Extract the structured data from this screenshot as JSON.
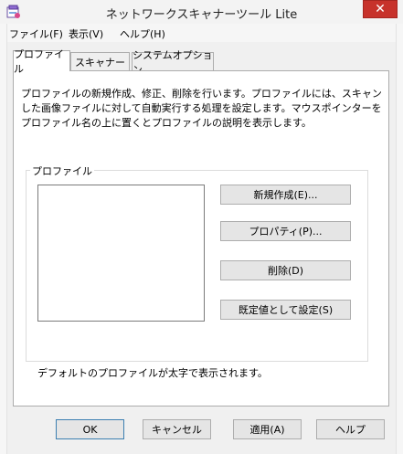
{
  "window": {
    "title": "ネットワークスキャナーツール Lite",
    "close_glyph": "✕",
    "app_icon": "scanner-app-icon"
  },
  "menu": [
    "ファイル(F)",
    "表示(V)",
    "ヘルプ(H)"
  ],
  "tabs": [
    {
      "label": "プロファイル",
      "active": true
    },
    {
      "label": "スキャナー",
      "active": false
    },
    {
      "label": "システムオプション",
      "active": false
    }
  ],
  "profile_tab": {
    "description": "プロファイルの新規作成、修正、削除を行います。プロファイルには、スキャンした画像ファイルに対して自動実行する処理を設定します。マウスポインターをプロファイル名の上に置くとプロファイルの説明を表示します。",
    "group_label": "プロファイル",
    "buttons": {
      "new": "新規作成(E)...",
      "properties": "プロパティ(P)...",
      "delete": "削除(D)",
      "set_default": "既定値として設定(S)"
    },
    "note": "デフォルトのプロファイルが太字で表示されます。"
  },
  "dialog_buttons": {
    "ok": "OK",
    "cancel": "キャンセル",
    "apply": "適用(A)",
    "help": "ヘルプ"
  },
  "colors": {
    "close_button": "#c7322b",
    "default_button_border": "#3c7fb1"
  }
}
